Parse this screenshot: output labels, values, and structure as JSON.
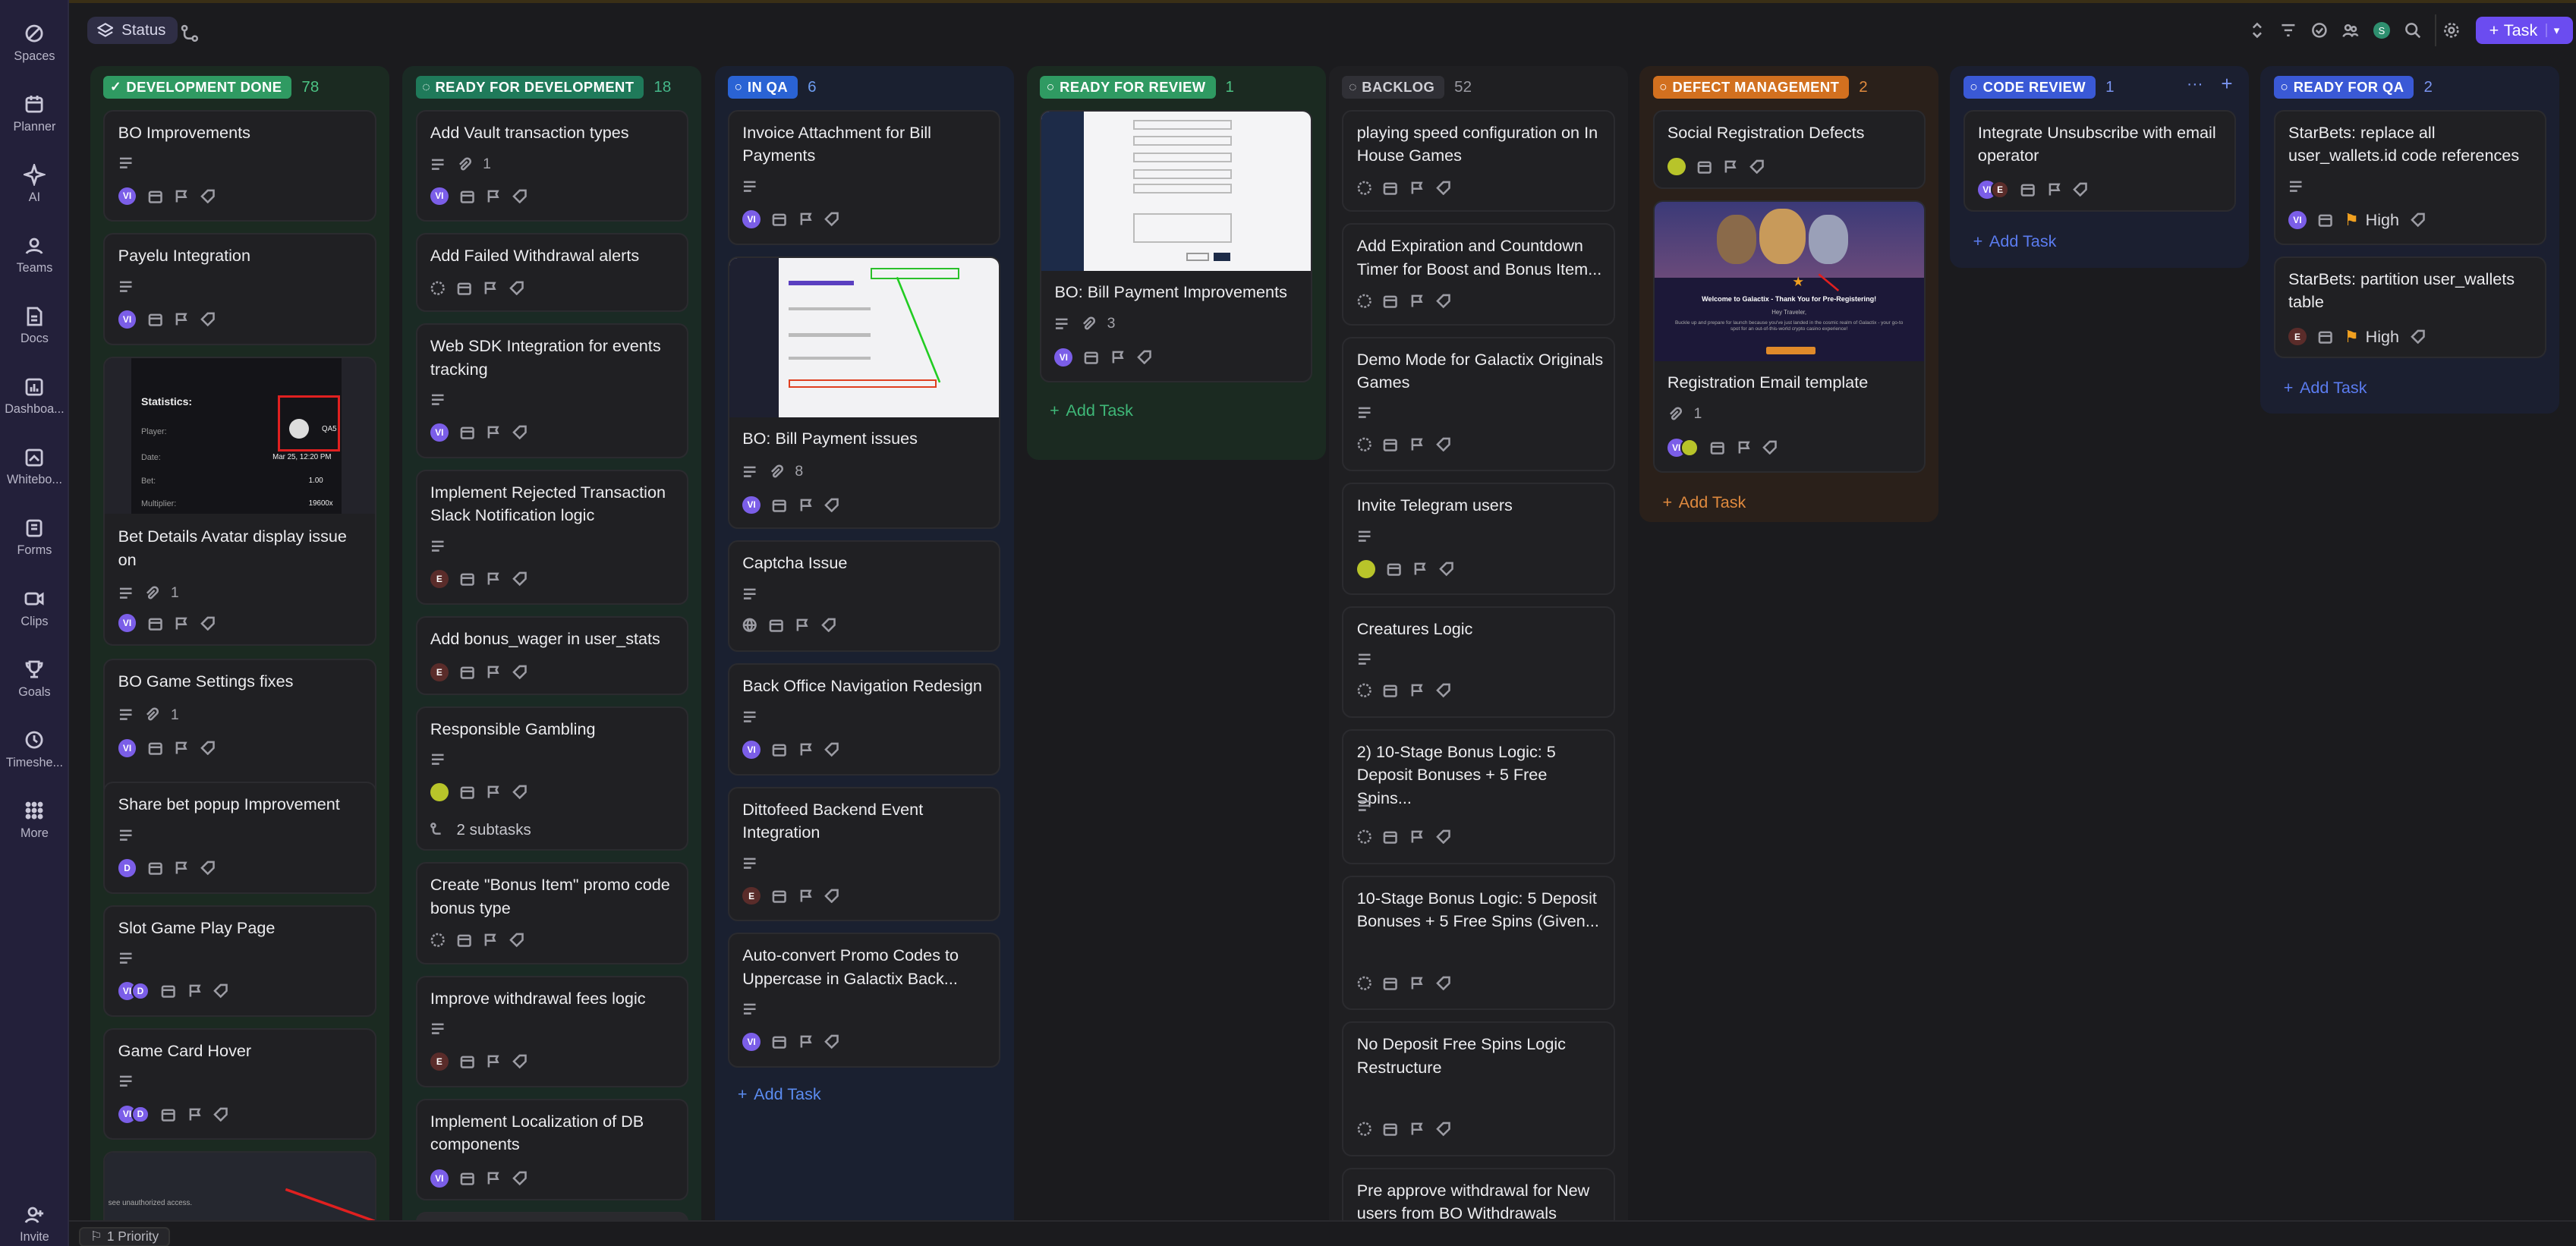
{
  "rail": [
    "Spaces",
    "Planner",
    "AI",
    "Teams",
    "Docs",
    "Dashboa...",
    "Whitebo...",
    "Forms",
    "Clips",
    "Goals",
    "Timeshe...",
    "More",
    "Invite"
  ],
  "topbar": {
    "view_label": "Status",
    "task_button": "Task",
    "user_initial": "S"
  },
  "bottombar": {
    "priority_label": "1 Priority"
  },
  "add_task_label": "Add Task",
  "subtasks_label": "2 subtasks",
  "priority_high": "High",
  "columns": [
    {
      "name": "DEVELOPMENT DONE",
      "count": "78",
      "color": "#2f9a62"
    },
    {
      "name": "READY FOR DEVELOPMENT",
      "count": "18",
      "color": "#1f7a5a"
    },
    {
      "name": "IN QA",
      "count": "6",
      "color": "#2a63d4"
    },
    {
      "name": "READY FOR REVIEW",
      "count": "1",
      "color": "#2f9a62"
    },
    {
      "name": "BACKLOG",
      "count": "52",
      "color": "#3a3a40"
    },
    {
      "name": "DEFECT MANAGEMENT",
      "count": "2",
      "color": "#d2701f"
    },
    {
      "name": "CODE REVIEW",
      "count": "1",
      "color": "#3a59d6"
    },
    {
      "name": "READY FOR QA",
      "count": "2",
      "color": "#3a59d6"
    }
  ],
  "cards": {
    "c0": [
      "BO Improvements",
      "Payelu Integration",
      "Bet Details Avatar display issue on",
      "BO Game Settings fixes",
      "Share bet popup Improvement",
      "Slot Game Play Page",
      "Game Card Hover"
    ],
    "c1": [
      "Add Vault transaction types",
      "Add Failed Withdrawal alerts",
      "Web SDK Integration for events tracking",
      "Implement Rejected Transaction Slack Notification logic",
      "Add bonus_wager in user_stats",
      "Responsible Gambling",
      "Create \"Bonus Item\" promo code bonus type",
      "Improve withdrawal fees logic",
      "Implement Localization of DB components"
    ],
    "c2": [
      "Invoice Attachment for Bill Payments",
      "BO: Bill Payment issues",
      "Captcha Issue",
      "Back Office Navigation Redesign",
      "Dittofeed Backend Event Integration",
      "Auto-convert Promo Codes to Uppercase in Galactix Back..."
    ],
    "c3": [
      "BO: Bill Payment Improvements"
    ],
    "c4": [
      "playing speed configuration on In House Games",
      "Add Expiration and Countdown Timer for Boost and Bonus Item...",
      "Demo Mode for Galactix Originals Games",
      "Invite Telegram users",
      "Creatures Logic",
      "2) 10-Stage Bonus Logic: 5 Deposit Bonuses + 5 Free Spins...",
      "10-Stage Bonus Logic: 5 Deposit Bonuses + 5 Free Spins (Given...",
      "No Deposit Free Spins Logic Restructure",
      "Pre approve withdrawal for New users from BO Withdrawals"
    ],
    "c5": [
      "Social Registration Defects",
      "Registration Email template"
    ],
    "c6": [
      "Integrate Unsubscribe with email operator"
    ],
    "c7": [
      "StarBets: replace all user_wallets.id code references",
      "StarBets: partition user_wallets table"
    ]
  },
  "counts": {
    "one": "1",
    "three": "3",
    "eight": "8"
  },
  "avatars": {
    "vi": "VI",
    "e": "E",
    "d": "D"
  },
  "thumbs": {
    "stats_title": "Statistics:",
    "player": "Player:",
    "date": "Date:",
    "bet": "Bet:",
    "multiplier": "Multiplier:",
    "qa5": "QA5",
    "date_val": "Mar 25, 12:20 PM",
    "bet_val": "1.00",
    "mult_val": "19600x",
    "unauth": "see unauthorized access.",
    "email_welcome": "Welcome to Galactix - Thank You for Pre-Registering!",
    "email_greet": "Hey Traveler,",
    "email_body": "Buckle up and prepare for launch because you've just landed in the cosmic realm of Galactix - your go-to spot for an out-of-this-world crypto casino experience!"
  }
}
